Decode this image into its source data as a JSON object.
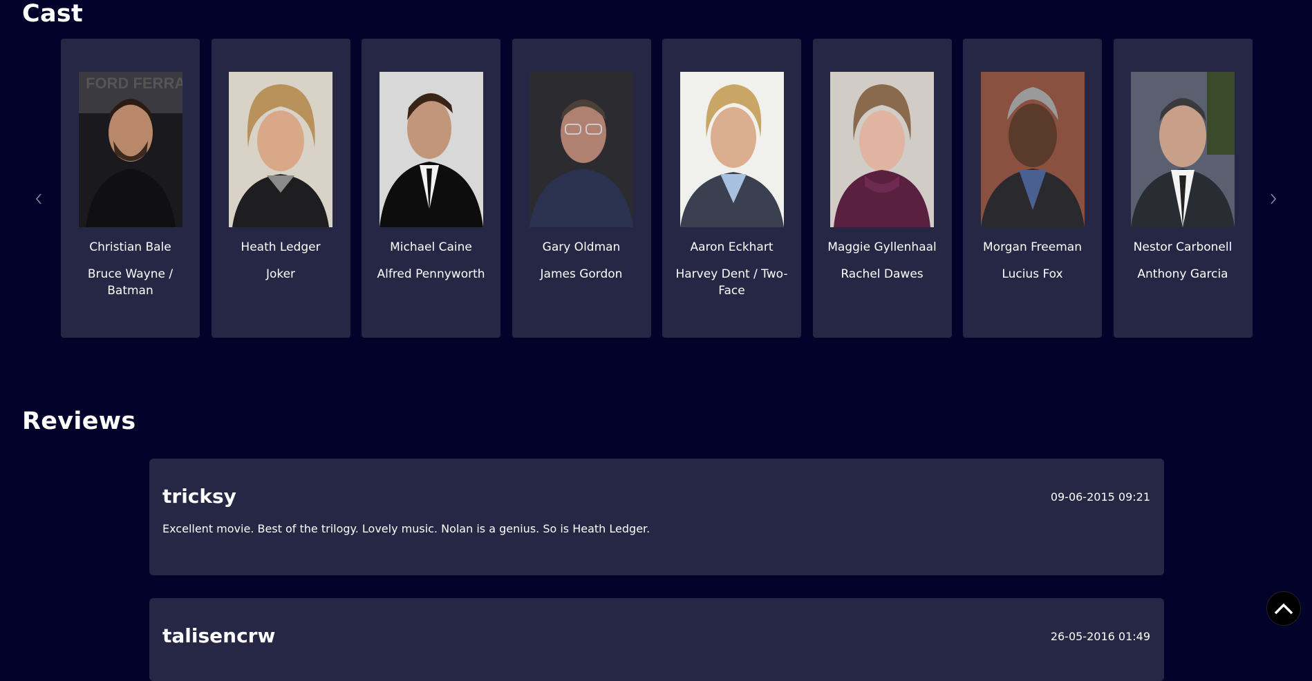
{
  "cast": {
    "title": "Cast",
    "members": [
      {
        "name": "Christian Bale",
        "character": "Bruce Wayne / Batman"
      },
      {
        "name": "Heath Ledger",
        "character": "Joker"
      },
      {
        "name": "Michael Caine",
        "character": "Alfred Pennyworth"
      },
      {
        "name": "Gary Oldman",
        "character": "James Gordon"
      },
      {
        "name": "Aaron Eckhart",
        "character": "Harvey Dent / Two-Face"
      },
      {
        "name": "Maggie Gyllenhaal",
        "character": "Rachel Dawes"
      },
      {
        "name": "Morgan Freeman",
        "character": "Lucius Fox"
      },
      {
        "name": "Nestor Carbonell",
        "character": "Anthony Garcia"
      }
    ],
    "prev_icon": "chevron-left-icon",
    "next_icon": "chevron-right-icon"
  },
  "reviews": {
    "title": "Reviews",
    "items": [
      {
        "author": "tricksy",
        "date": "09-06-2015 09:21",
        "text": "Excellent movie. Best of the trilogy. Lovely music. Nolan is a genius. So is Heath Ledger."
      },
      {
        "author": "talisencrw",
        "date": "26-05-2016 01:49",
        "text": ""
      }
    ]
  },
  "scroll_top_icon": "chevron-up-icon",
  "colors": {
    "background": "#03022a",
    "card": "#262645",
    "text": "#ffffff"
  }
}
